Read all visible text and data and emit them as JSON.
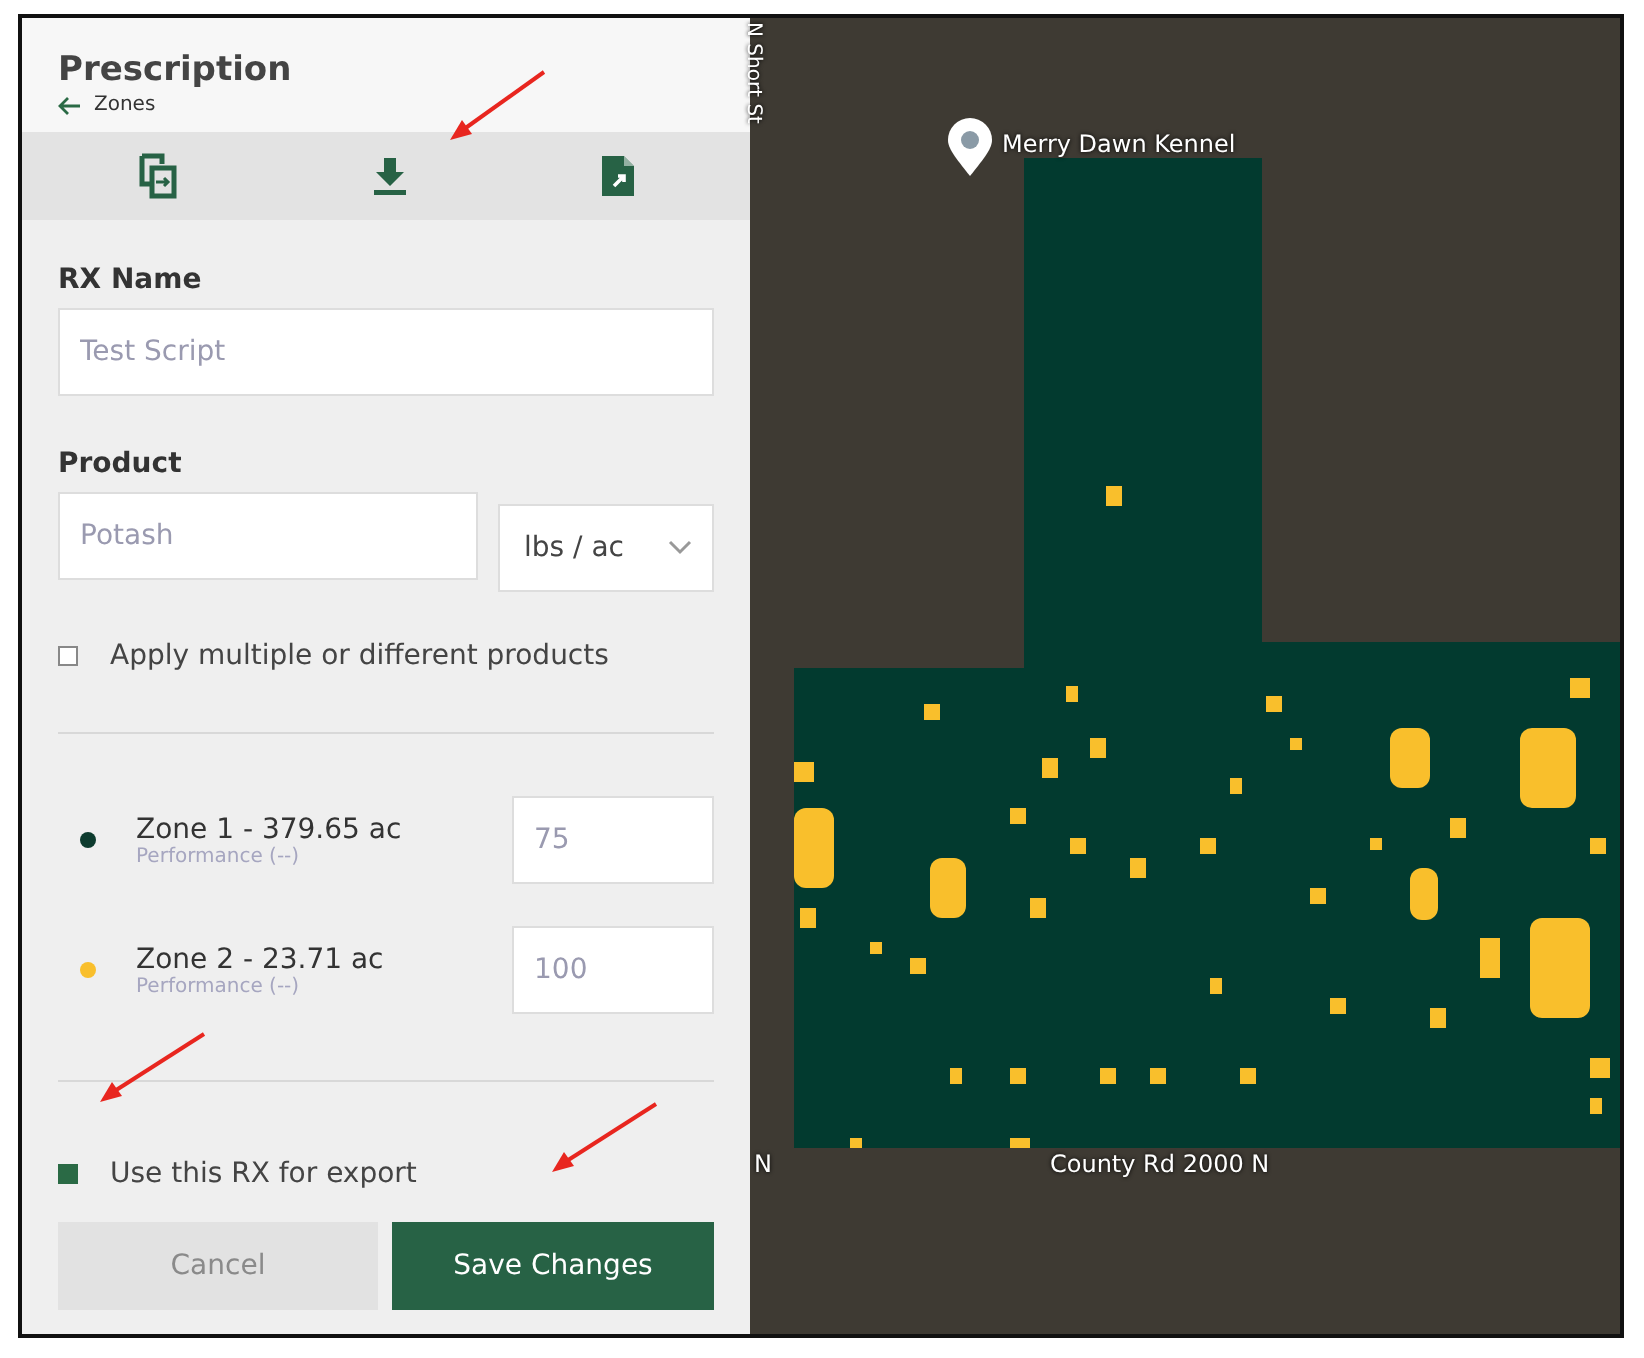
{
  "panel": {
    "title": "Prescription",
    "back_link": "Zones"
  },
  "form": {
    "rx_name": {
      "label": "RX Name",
      "placeholder": "Test Script"
    },
    "product": {
      "label": "Product",
      "placeholder": "Potash",
      "unit": "lbs / ac"
    },
    "multiple_products": {
      "label": "Apply multiple or different products",
      "checked": false
    }
  },
  "zones": [
    {
      "name": "Zone 1 - 379.65 ac",
      "performance": "Performance (--)",
      "color": "#0d3b2e",
      "rate_placeholder": "75"
    },
    {
      "name": "Zone 2 - 23.71 ac",
      "performance": "Performance (--)",
      "color": "#f9bf2c",
      "rate_placeholder": "100"
    }
  ],
  "export": {
    "label": "Use this RX for export",
    "checked": true
  },
  "buttons": {
    "cancel": "Cancel",
    "save": "Save Changes"
  },
  "map": {
    "place_label": "Merry Dawn Kennel",
    "road_label": "County Rd 2000 N",
    "street_label": "N Short St",
    "edge_label": "N"
  }
}
